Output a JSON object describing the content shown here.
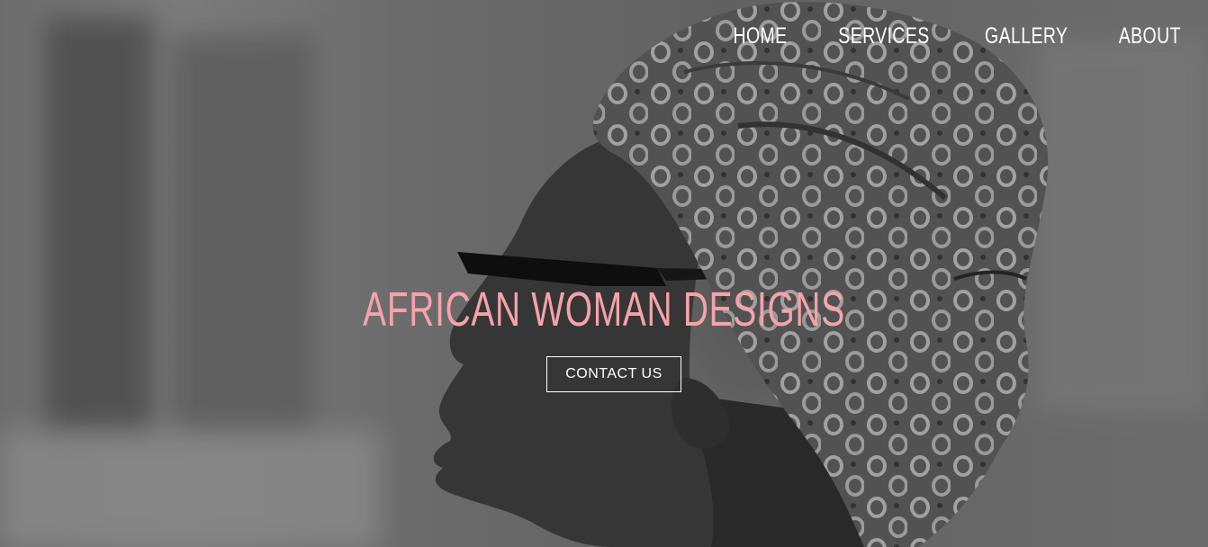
{
  "nav": {
    "items": [
      {
        "label": "HOME"
      },
      {
        "label": "SERVICES"
      },
      {
        "label": "GALLERY"
      },
      {
        "label": "ABOUT"
      }
    ]
  },
  "hero": {
    "title": "AFRICAN WOMAN DESIGNS",
    "cta_label": "CONTACT US",
    "title_color": "#f5a3a8",
    "photo": "grayscale-portrait-woman-headwrap-sunglasses"
  }
}
